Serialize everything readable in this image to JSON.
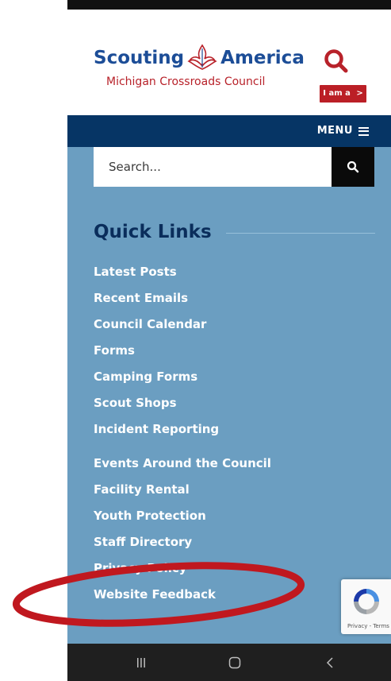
{
  "header": {
    "logo_primary_left": "Scouting",
    "logo_primary_right": "America",
    "logo_sub": "Michigan Crossroads Council",
    "iam_label": "I am a",
    "iam_arrow": ">"
  },
  "nav": {
    "menu_label": "MENU"
  },
  "search": {
    "placeholder": "Search..."
  },
  "quick_links": {
    "title": "Quick Links",
    "items": [
      "Latest Posts",
      "Recent Emails",
      "Council Calendar",
      "Forms",
      "Camping Forms",
      "Scout Shops",
      "Incident Reporting",
      "Events Around the Council",
      "Facility Rental",
      "Youth Protection",
      "Staff Directory",
      "Privacy Policy",
      "Website Feedback"
    ]
  },
  "recaptcha": {
    "text": "Privacy - Terms"
  },
  "colors": {
    "brand_blue": "#1c4d97",
    "brand_red": "#b8222a",
    "nav_bg": "#063565",
    "content_bg": "#6b9ec1",
    "annotation": "#c0181f"
  },
  "icons": [
    "search-icon",
    "hamburger-icon",
    "chevron-right-icon",
    "recaptcha-icon",
    "recents-icon",
    "home-icon",
    "back-icon"
  ]
}
